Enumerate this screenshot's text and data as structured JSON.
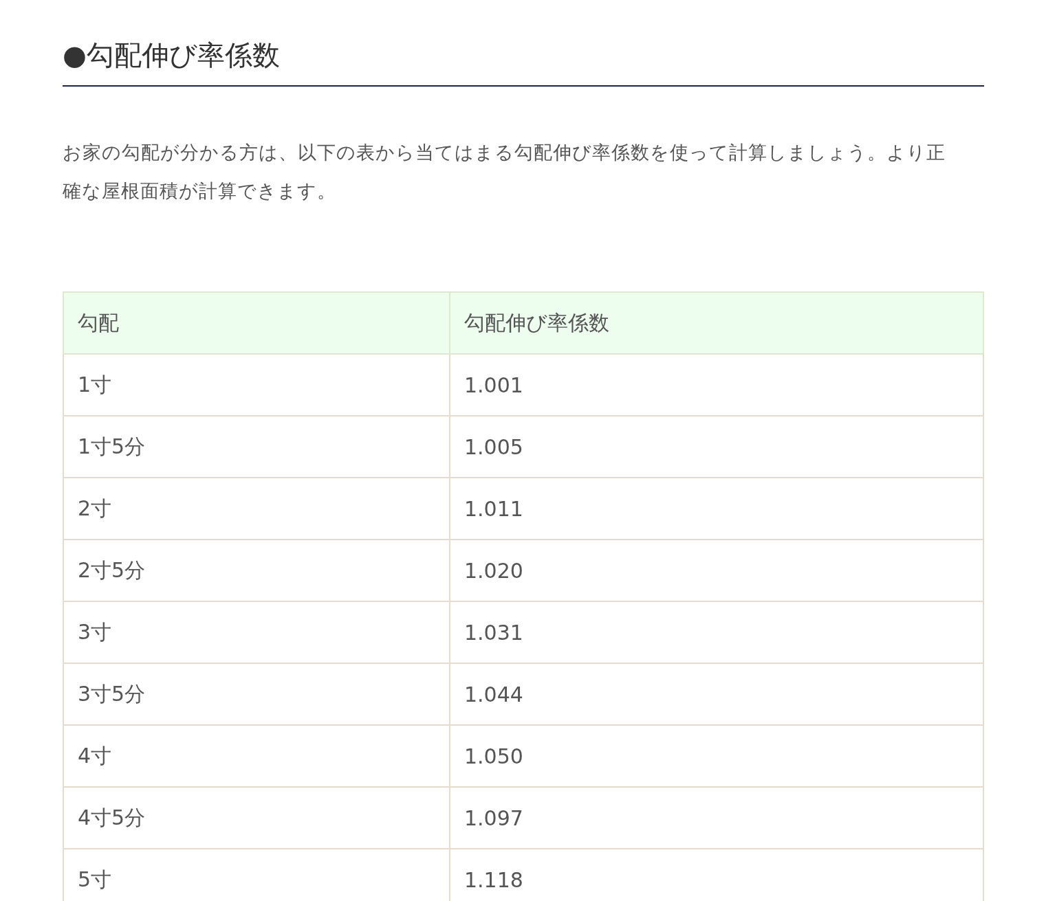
{
  "heading": "●勾配伸び率係数",
  "paragraph": "お家の勾配が分かる方は、以下の表から当てはまる勾配伸び率係数を使って計算しましょう。より正確な屋根面積が計算できます。",
  "table": {
    "columns": [
      "勾配",
      "勾配伸び率係数"
    ],
    "rows": [
      [
        "1寸",
        "1.001"
      ],
      [
        "1寸5分",
        "1.005"
      ],
      [
        "2寸",
        "1.011"
      ],
      [
        "2寸5分",
        "1.020"
      ],
      [
        "3寸",
        "1.031"
      ],
      [
        "3寸5分",
        "1.044"
      ],
      [
        "4寸",
        "1.050"
      ],
      [
        "4寸5分",
        "1.097"
      ],
      [
        "5寸",
        "1.118"
      ]
    ]
  }
}
